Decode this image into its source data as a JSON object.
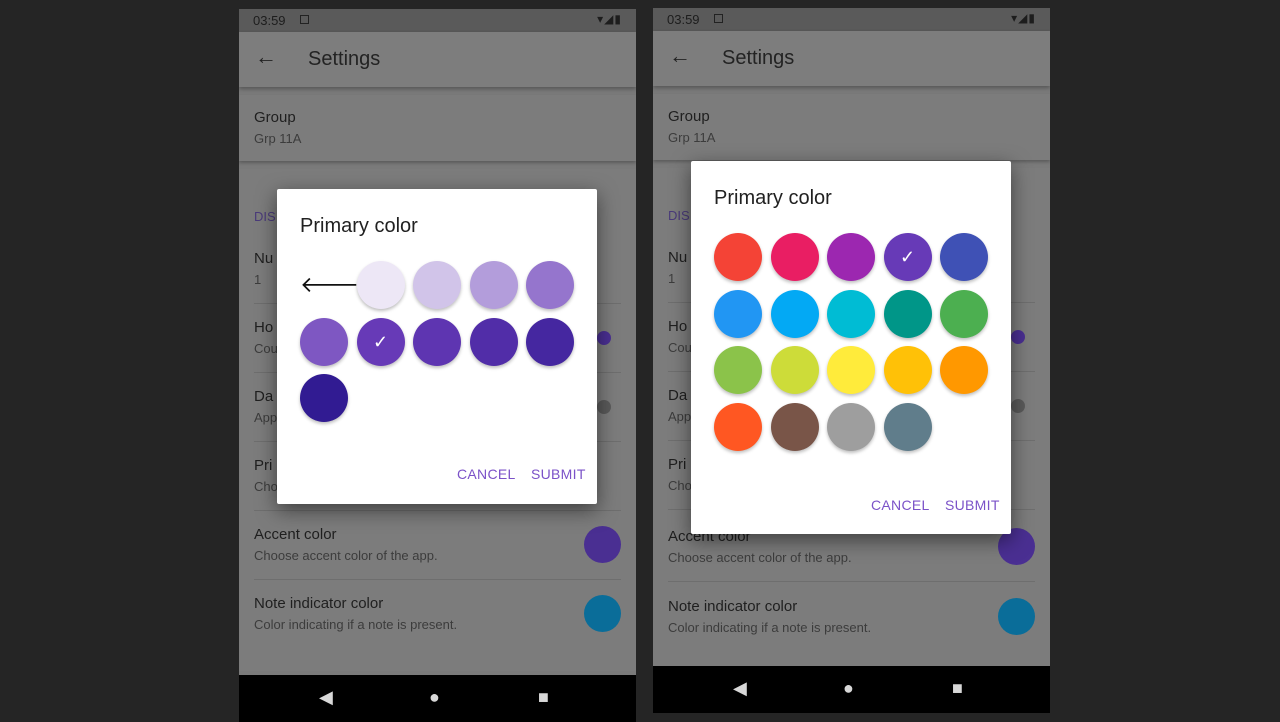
{
  "status_bar": {
    "time": "03:59",
    "system_icons": "▾◢▮"
  },
  "app_bar": {
    "back_icon": "←",
    "title": "Settings"
  },
  "group_setting": {
    "title": "Group",
    "value": "Grp 11A"
  },
  "background_left": {
    "section_header": "DIS",
    "num_title": "Nu",
    "num_value": "1",
    "hol_title": "Ho",
    "hol_sub": "Cou",
    "dark_title": "Da",
    "dark_sub": "App",
    "prim_title": "Pri",
    "prim_sub": "Cho"
  },
  "background_right": {
    "section_header": "DIS",
    "num_title": "Nu",
    "num_value": "1",
    "hol_title": "Ho",
    "hol_sub": "Cou",
    "dark_title": "Da",
    "dark_sub": "App",
    "prim_title": "Pri",
    "prim_sub": "Cho"
  },
  "accent_setting": {
    "title": "Accent color",
    "subtitle": "Choose accent color of the app."
  },
  "note_setting": {
    "title": "Note indicator color",
    "subtitle": "Color indicating if a note is present."
  },
  "nav_bar": {
    "back": "◀",
    "home": "●",
    "recents": "■"
  },
  "dialog_left": {
    "title": "Primary color",
    "back_icon": "🡐",
    "shades": [
      "#ede7f6",
      "#d1c4e9",
      "#b39ddb",
      "#9575cd",
      "#7e57c2",
      "#673ab7",
      "#5e35b1",
      "#512da8",
      "#4527a0",
      "#311b92"
    ],
    "selected_index": 5,
    "check_icon": "✓",
    "cancel_label": "CANCEL",
    "submit_label": "SUBMIT"
  },
  "dialog_right": {
    "title": "Primary color",
    "colors": [
      "#f44336",
      "#e91e63",
      "#9c27b0",
      "#673ab7",
      "#3f51b5",
      "#2196f3",
      "#03a9f4",
      "#00bcd4",
      "#009688",
      "#4caf50",
      "#8bc34a",
      "#cddc39",
      "#ffeb3b",
      "#ffc107",
      "#ff9800",
      "#ff5722",
      "#795548",
      "#9e9e9e",
      "#607d8b"
    ],
    "selected_index": 3,
    "check_icon": "✓",
    "cancel_label": "CANCEL",
    "submit_label": "SUBMIT"
  },
  "accent_dot_color": "#4a2f92",
  "note_dot_color": "#0a6d99",
  "hol_toggle_color": "#4a2f92"
}
